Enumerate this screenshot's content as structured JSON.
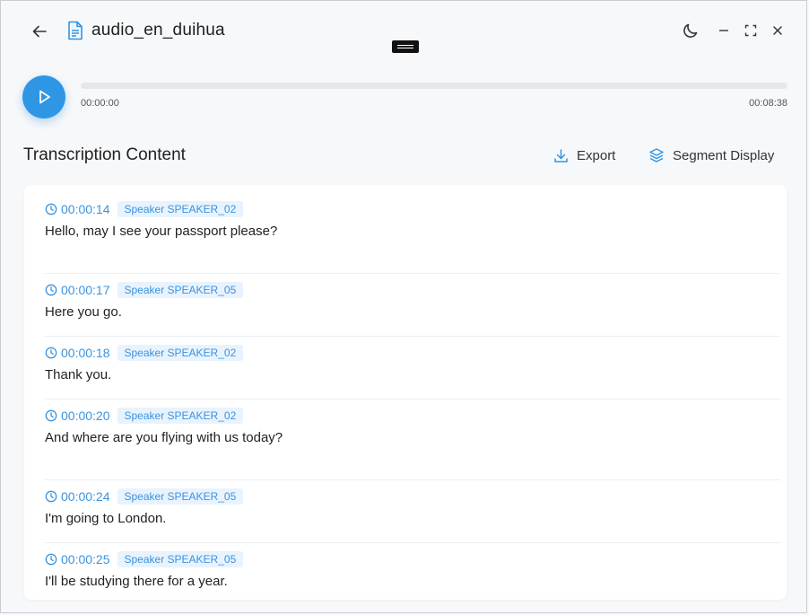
{
  "window": {
    "title": "audio_en_duihua"
  },
  "player": {
    "current_time": "00:00:00",
    "duration": "00:08:38",
    "progress": 0
  },
  "transcription": {
    "title": "Transcription Content",
    "export_label": "Export",
    "segment_display_label": "Segment Display",
    "segments": [
      {
        "time": "00:00:14",
        "speaker": "Speaker SPEAKER_02",
        "text": "Hello, may I see your passport please?"
      },
      {
        "time": "00:00:17",
        "speaker": "Speaker SPEAKER_05",
        "text": "Here you go."
      },
      {
        "time": "00:00:18",
        "speaker": "Speaker SPEAKER_02",
        "text": "Thank you."
      },
      {
        "time": "00:00:20",
        "speaker": "Speaker SPEAKER_02",
        "text": "And where are you flying with us today?"
      },
      {
        "time": "00:00:24",
        "speaker": "Speaker SPEAKER_05",
        "text": "I'm going to London."
      },
      {
        "time": "00:00:25",
        "speaker": "Speaker SPEAKER_05",
        "text": "I'll be studying there for a year."
      }
    ]
  },
  "colors": {
    "accent": "#2f96e6",
    "badge_bg": "#e8f3fd",
    "timestamp": "#3a93e0"
  },
  "icons": [
    "back-arrow-icon",
    "document-icon",
    "moon-icon",
    "minimize-icon",
    "maximize-icon",
    "close-icon",
    "play-icon",
    "download-icon",
    "layers-icon",
    "clock-icon"
  ]
}
